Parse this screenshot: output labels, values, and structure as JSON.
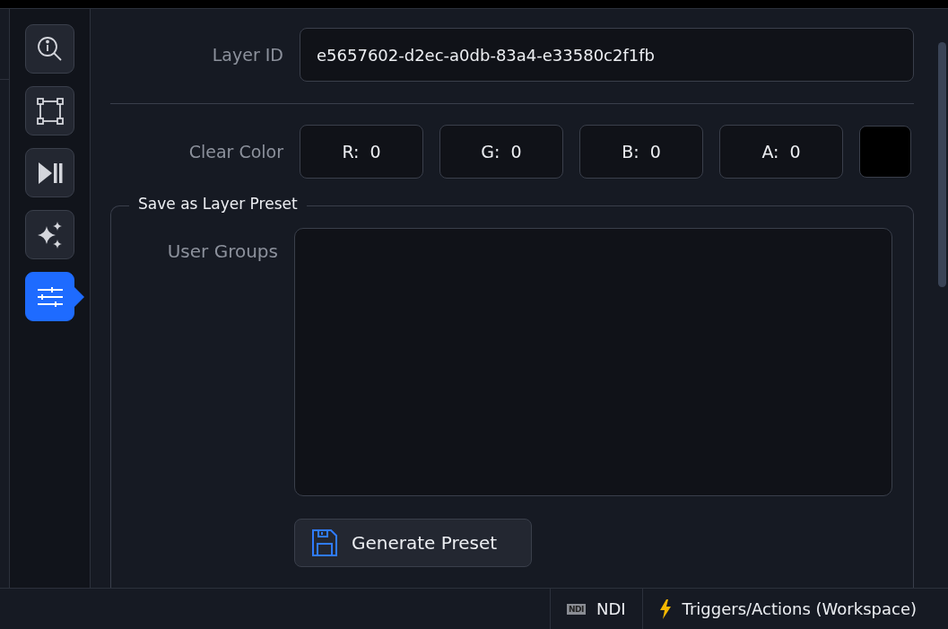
{
  "sidebar": {
    "items": [
      {
        "kind": "inspect",
        "selected": false
      },
      {
        "kind": "transform",
        "selected": false
      },
      {
        "kind": "playback",
        "selected": false
      },
      {
        "kind": "effects",
        "selected": false
      },
      {
        "kind": "settings",
        "selected": true
      }
    ]
  },
  "layer_id": {
    "label": "Layer ID",
    "value": "e5657602-d2ec-a0db-83a4-e33580c2f1fb"
  },
  "clear_color": {
    "label": "Clear Color",
    "channels": [
      {
        "label": "R:",
        "value": "0"
      },
      {
        "label": "G:",
        "value": "0"
      },
      {
        "label": "B:",
        "value": "0"
      },
      {
        "label": "A:",
        "value": "0"
      }
    ],
    "color": "#000000"
  },
  "preset": {
    "legend": "Save as Layer Preset",
    "user_groups_label": "User Groups",
    "button": "Generate Preset"
  },
  "status_bar": {
    "items": [
      {
        "kind": "ndi",
        "badge": "NDI",
        "label": "NDI"
      },
      {
        "kind": "triggers",
        "label": "Triggers/Actions (Workspace)"
      }
    ]
  }
}
